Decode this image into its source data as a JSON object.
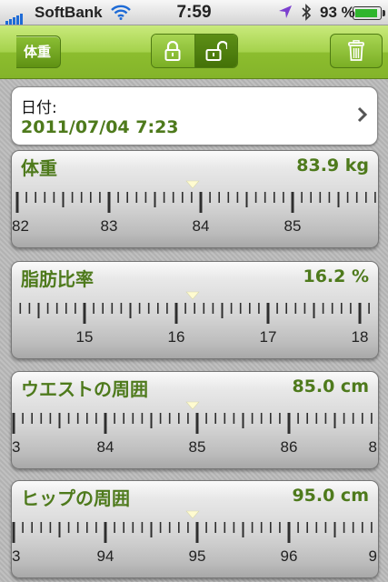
{
  "status_bar": {
    "carrier": "SoftBank",
    "time": "7:59",
    "battery": "93 %"
  },
  "nav": {
    "back_label": "体重"
  },
  "date_card": {
    "label": "日付:",
    "value": "2011/07/04 7:23"
  },
  "rulers": [
    {
      "name": "体重",
      "value": "83.9 kg",
      "labels": [
        "82",
        "83",
        "84",
        "85"
      ]
    },
    {
      "name": "脂肪比率",
      "value": "16.2 %",
      "labels": [
        "15",
        "16",
        "17",
        "18"
      ]
    },
    {
      "name": "ウエストの周囲",
      "value": "85.0 cm",
      "labels": [
        "3",
        "84",
        "85",
        "86",
        "8"
      ]
    },
    {
      "name": "ヒップの周囲",
      "value": "95.0 cm",
      "labels": [
        "3",
        "94",
        "95",
        "96",
        "9"
      ]
    }
  ]
}
